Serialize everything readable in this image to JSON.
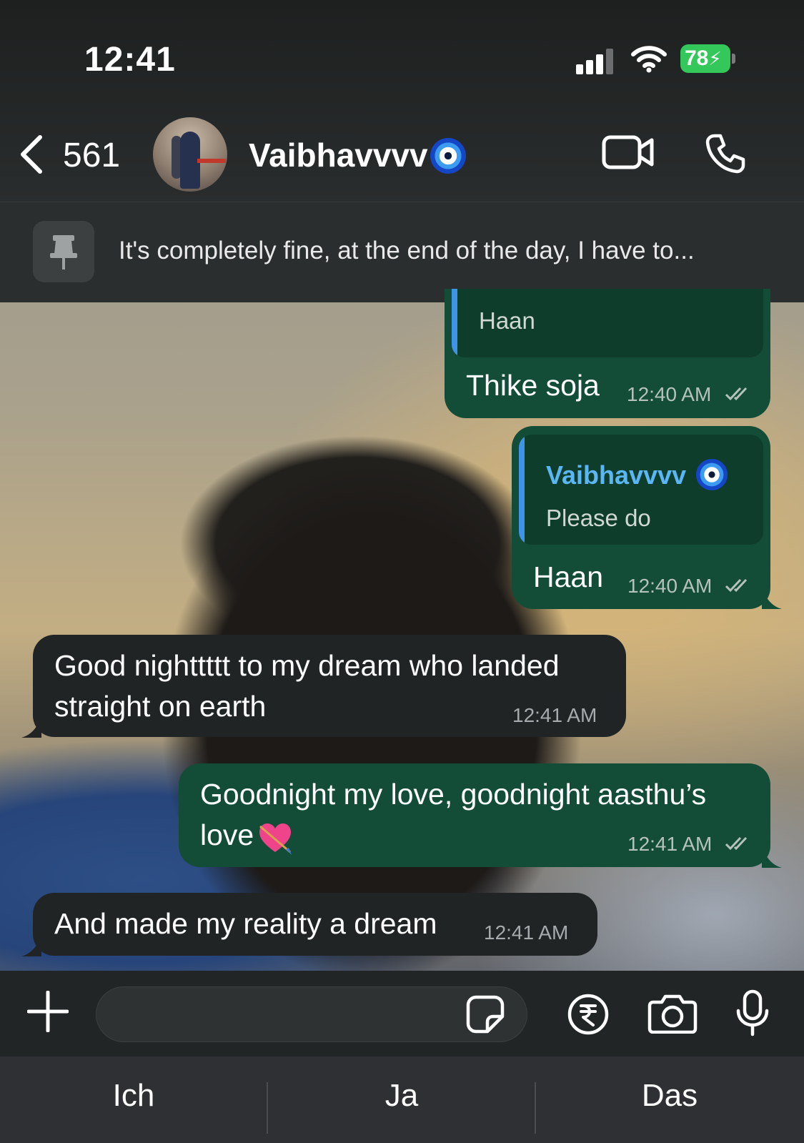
{
  "status_bar": {
    "time": "12:41",
    "battery": "78"
  },
  "header": {
    "back_count": "561",
    "contact_name": "Vaibhavvvv"
  },
  "pinned": {
    "text": "It's completely fine, at the end of the day, I have to..."
  },
  "messages": [
    {
      "dir": "out",
      "quote_text": "Haan",
      "text": "Thike soja",
      "time": "12:40 AM"
    },
    {
      "dir": "out",
      "quote_name": "Vaibhavvvv",
      "quote_text": "Please do",
      "text": "Haan",
      "time": "12:40 AM"
    },
    {
      "dir": "in",
      "line1": "Good nighttttt to my dream who landed",
      "line2": "straight on earth",
      "time": "12:41 AM"
    },
    {
      "dir": "out",
      "line1": "Goodnight my love, goodnight aasthu’s",
      "line2": "love",
      "time": "12:41 AM"
    },
    {
      "dir": "in",
      "text": "And made my reality a dream",
      "time": "12:41 AM"
    }
  ],
  "composer": {
    "value": "",
    "placeholder": ""
  },
  "suggestions": [
    "Ich",
    "Ja",
    "Das"
  ],
  "colors": {
    "outgoing_bubble": "#134d37",
    "incoming_bubble": "#202425",
    "accent_blue": "#5ab6f4",
    "battery_green": "#34c759"
  },
  "icons": [
    "back-chevron-icon",
    "evil-eye-emoji-icon",
    "video-call-icon",
    "phone-icon",
    "pin-icon",
    "double-check-icon",
    "heart-arrow-emoji-icon",
    "plus-icon",
    "sticker-icon",
    "rupee-icon",
    "camera-icon",
    "mic-icon"
  ]
}
